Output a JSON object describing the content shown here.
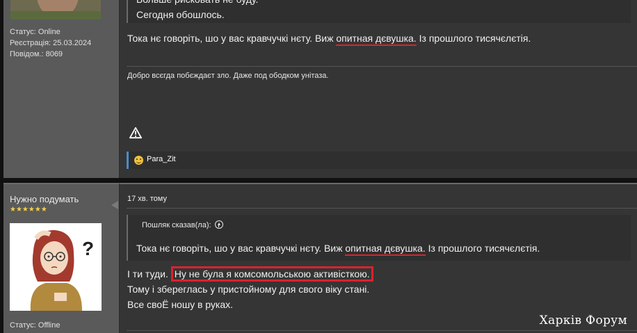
{
  "post1": {
    "user_status": "Статус: Online",
    "user_registered": "Реєстрація: 25.03.2024",
    "user_posts": "Повідом.: 8069",
    "quote_lines": [
      "Больше рисковать не буду.",
      "Сегодня обошлось."
    ],
    "text_before": "Тока нє говоріть, шо у вас кравчучкі нєту. Виж ",
    "text_highlight": "опитная дєвушка.",
    "text_after": " Із прошлого тисячєлєтія.",
    "signature": "Добро всєгда побєждаєт зло. Даже под ободком унітаза.",
    "liker": "Para_Zit"
  },
  "post2": {
    "username": "Нужно подумать",
    "stars": "★★★★★★",
    "user_status": "Статус: Offline",
    "time": "17 хв. тому",
    "quote_author": "Пошляк сказав(ла):",
    "quote_before": "Тока нє говоріть, шо у вас кравчучкі нєту. Виж ",
    "quote_highlight": "опитная дєвушка.",
    "quote_after": " Із прошлого тисячєлєтія.",
    "line1_prefix": "І ти туди. ",
    "line1_boxed": "Ну не була я комсомольською активісткою.",
    "line2": "Тому і збереглась у пристойному для свого віку стані.",
    "line3": "Все своЁ ношу в руках."
  },
  "watermark": "Харків Форум",
  "colors": {
    "accent_red": "#d9232d",
    "quote_accent_blue": "#4a8cc9",
    "sidebar_bg": "#5a5a5a",
    "main_bg": "#353535"
  }
}
